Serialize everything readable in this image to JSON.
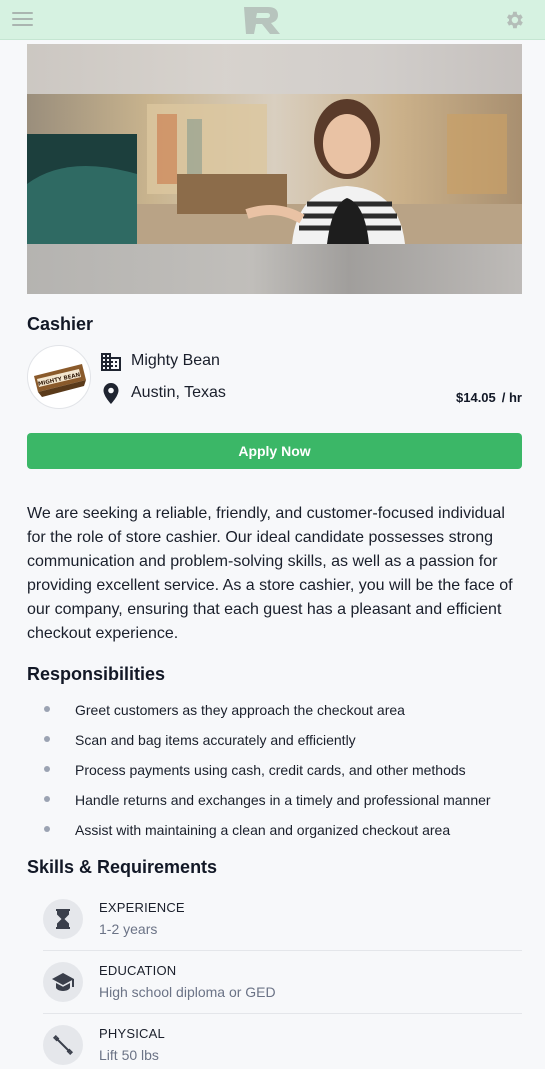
{
  "header": {
    "menu_icon": "hamburger-menu-icon",
    "logo": "R",
    "settings_icon": "gear-icon"
  },
  "job": {
    "title": "Cashier",
    "company": "Mighty Bean",
    "company_logo_text": "MIGHTY BEAN",
    "location": "Austin, Texas",
    "pay_amount": "$14.05",
    "pay_unit": "/ hr",
    "apply_label": "Apply Now",
    "description": "We are seeking a reliable, friendly, and customer-focused individual for the role of store cashier. Our ideal candidate possesses strong communication and problem-solving skills, as well as a passion for providing excellent service. As a store cashier, you will be the face of our company, ensuring that each guest has a pleasant and efficient checkout experience."
  },
  "responsibilities": {
    "title": "Responsibilities",
    "items": [
      "Greet customers as they approach the checkout area",
      "Scan and bag items accurately and efficiently",
      "Process payments using cash, credit cards, and other methods",
      "Handle returns and exchanges in a timely and professional manner",
      "Assist with maintaining a clean and organized checkout area"
    ]
  },
  "skills": {
    "title": "Skills & Requirements",
    "items": [
      {
        "label": "EXPERIENCE",
        "value": "1-2 years",
        "icon": "hourglass-icon"
      },
      {
        "label": "EDUCATION",
        "value": "High school diploma or GED",
        "icon": "graduation-cap-icon"
      },
      {
        "label": "PHYSICAL",
        "value": "Lift 50 lbs",
        "icon": "dumbbell-icon"
      }
    ]
  },
  "colors": {
    "header_bg": "#d6f2e1",
    "accent_green": "#3bb767",
    "muted_text": "#6b7386"
  }
}
